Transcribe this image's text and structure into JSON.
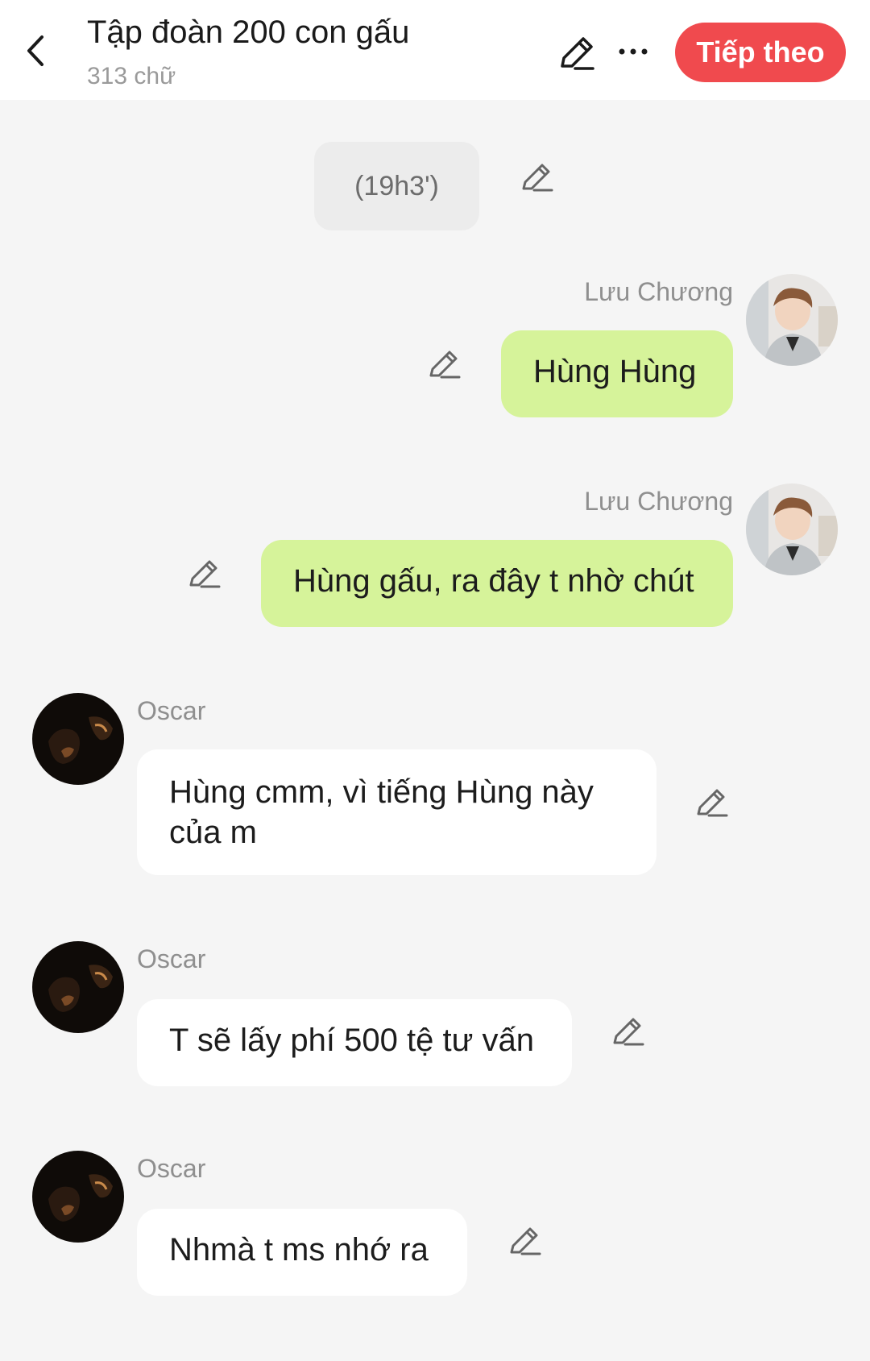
{
  "header": {
    "title": "Tập đoàn 200 con gấu",
    "word_count": "313 chữ",
    "next_button": "Tiếp theo"
  },
  "timestamp": "(19h3')",
  "messages": [
    {
      "sender": "Lưu Chương",
      "text": "Hùng Hùng",
      "side": "right"
    },
    {
      "sender": "Lưu Chương",
      "text": "Hùng gấu, ra đây t nhờ chút",
      "side": "right"
    },
    {
      "sender": "Oscar",
      "text": "Hùng cmm, vì tiếng Hùng này của m",
      "side": "left"
    },
    {
      "sender": "Oscar",
      "text": "T sẽ lấy phí 500 tệ tư vấn",
      "side": "left"
    },
    {
      "sender": "Oscar",
      "text": "Nhmà t ms nhớ ra",
      "side": "left"
    }
  ],
  "colors": {
    "accent": "#f04a4e",
    "my_bubble": "#d6f39a",
    "other_bubble": "#ffffff",
    "background": "#f5f5f5"
  },
  "icons": [
    "back-arrow-icon",
    "pencil-icon",
    "more-icon"
  ]
}
